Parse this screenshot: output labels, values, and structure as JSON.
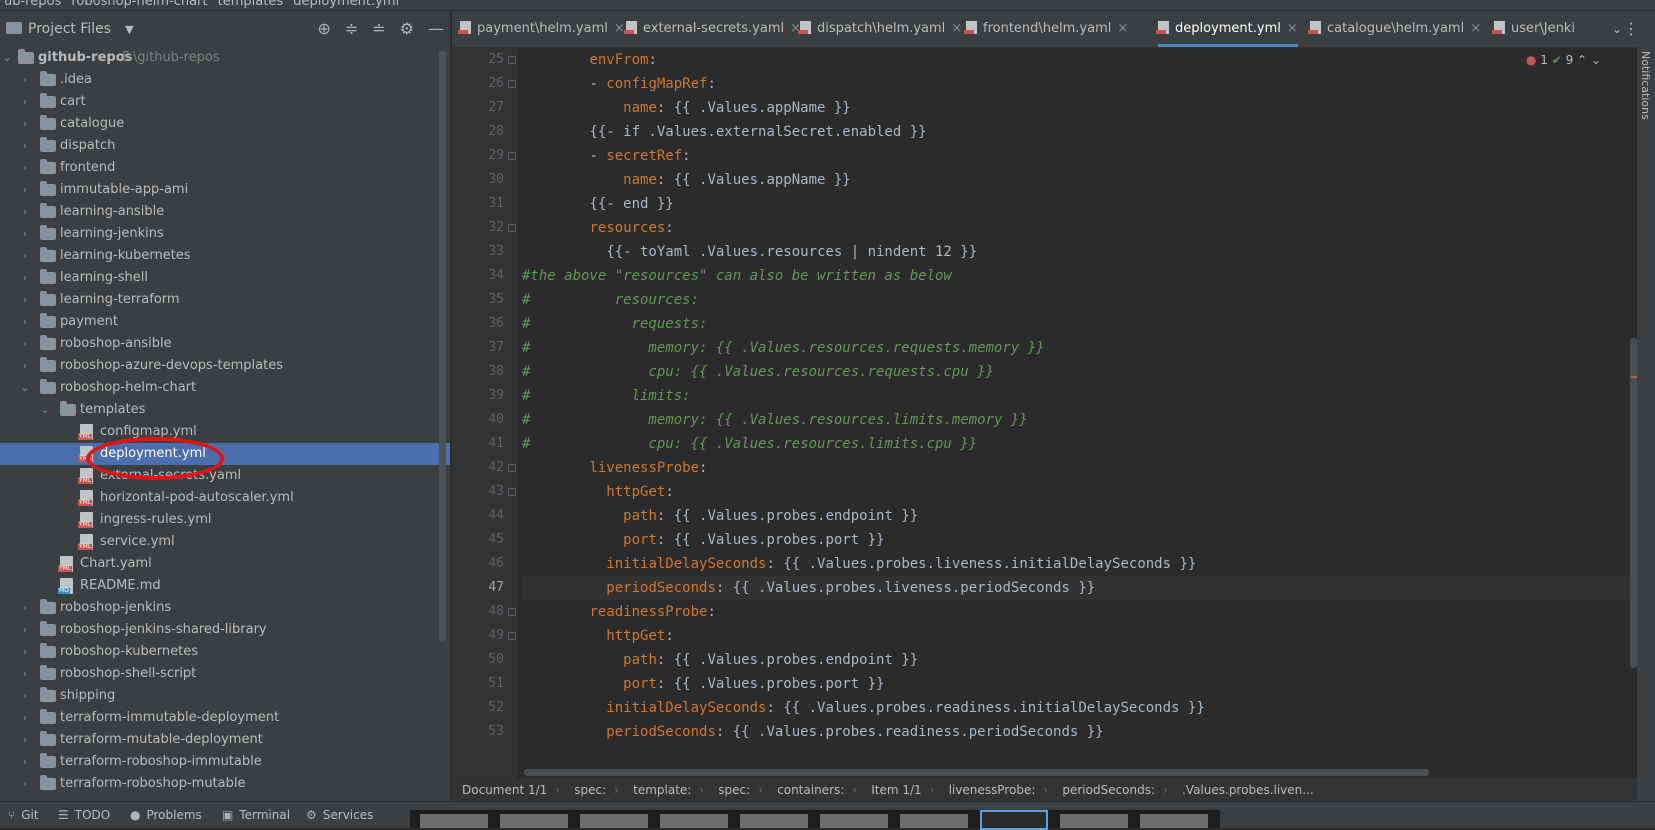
{
  "breadcrumb_top": [
    "ub-repos",
    "roboshop-helm-chart",
    "templates",
    "deployment.yml"
  ],
  "project_panel": {
    "title": "Project Files",
    "root": {
      "name": "github-repos",
      "path": "F:\\github-repos"
    },
    "items": [
      {
        "label": "idea"
      },
      {
        "label": "cart"
      },
      {
        "label": "catalogue"
      },
      {
        "label": "dispatch"
      },
      {
        "label": "frontend"
      },
      {
        "label": "immutable-app-ami"
      },
      {
        "label": "learning-ansible"
      },
      {
        "label": "learning-jenkins"
      },
      {
        "label": "learning-kubernetes"
      },
      {
        "label": "learning-shell"
      },
      {
        "label": "learning-terraform"
      },
      {
        "label": "payment"
      },
      {
        "label": "roboshop-ansible"
      },
      {
        "label": "roboshop-azure-devops-templates"
      },
      {
        "label": "roboshop-helm-chart"
      },
      {
        "label": "templates"
      },
      {
        "label": "configmap.yml"
      },
      {
        "label": "deployment.yml"
      },
      {
        "label": "external-secrets.yaml"
      },
      {
        "label": "horizontal-pod-autoscaler.yml"
      },
      {
        "label": "ingress-rules.yml"
      },
      {
        "label": "service.yml"
      },
      {
        "label": "Chart.yaml"
      },
      {
        "label": "README.md"
      },
      {
        "label": "roboshop-jenkins"
      },
      {
        "label": "roboshop-jenkins-shared-library"
      },
      {
        "label": "roboshop-kubernetes"
      },
      {
        "label": "roboshop-shell-script"
      },
      {
        "label": "shipping"
      },
      {
        "label": "terraform-immutable-deployment"
      },
      {
        "label": "terraform-mutable-deployment"
      },
      {
        "label": "terraform-roboshop-immutable"
      },
      {
        "label": "terraform-roboshop-mutable"
      }
    ]
  },
  "tabs": [
    {
      "label": "payment\\helm.yaml"
    },
    {
      "label": "external-secrets.yaml"
    },
    {
      "label": "dispatch\\helm.yaml"
    },
    {
      "label": "frontend\\helm.yaml"
    },
    {
      "label": "deployment.yml"
    },
    {
      "label": "catalogue\\helm.yaml"
    },
    {
      "label": "user\\Jenki"
    }
  ],
  "inspections": {
    "errors": "1",
    "ok": "9"
  },
  "editor": {
    "current_line": 47,
    "lines": [
      {
        "n": "25",
        "text": "        envFrom:"
      },
      {
        "n": "26",
        "text": "        - configMapRef:"
      },
      {
        "n": "27",
        "text": "            name: {{ .Values.appName }}"
      },
      {
        "n": "28",
        "text": "        {{- if .Values.externalSecret.enabled }}"
      },
      {
        "n": "29",
        "text": "        - secretRef:"
      },
      {
        "n": "30",
        "text": "            name: {{ .Values.appName }}"
      },
      {
        "n": "31",
        "text": "        {{- end }}"
      },
      {
        "n": "32",
        "text": "        resources:"
      },
      {
        "n": "33",
        "text": "          {{- toYaml .Values.resources | nindent 12 }}"
      },
      {
        "n": "34",
        "text": "#the above \"resources\" can also be written as below"
      },
      {
        "n": "35",
        "text": "#          resources:"
      },
      {
        "n": "36",
        "text": "#            requests:"
      },
      {
        "n": "37",
        "text": "#              memory: {{ .Values.resources.requests.memory }}"
      },
      {
        "n": "38",
        "text": "#              cpu: {{ .Values.resources.requests.cpu }}"
      },
      {
        "n": "39",
        "text": "#            limits:"
      },
      {
        "n": "40",
        "text": "#              memory: {{ .Values.resources.limits.memory }}"
      },
      {
        "n": "41",
        "text": "#              cpu: {{ .Values.resources.limits.cpu }}"
      },
      {
        "n": "42",
        "text": "        livenessProbe:"
      },
      {
        "n": "43",
        "text": "          httpGet:"
      },
      {
        "n": "44",
        "text": "            path: {{ .Values.probes.endpoint }}"
      },
      {
        "n": "45",
        "text": "            port: {{ .Values.probes.port }}"
      },
      {
        "n": "46",
        "text": "          initialDelaySeconds: {{ .Values.probes.liveness.initialDelaySeconds }}"
      },
      {
        "n": "47",
        "text": "          periodSeconds: {{ .Values.probes.liveness.periodSeconds }}"
      },
      {
        "n": "48",
        "text": "        readinessProbe:"
      },
      {
        "n": "49",
        "text": "          httpGet:"
      },
      {
        "n": "50",
        "text": "            path: {{ .Values.probes.endpoint }}"
      },
      {
        "n": "51",
        "text": "            port: {{ .Values.probes.port }}"
      },
      {
        "n": "52",
        "text": "          initialDelaySeconds: {{ .Values.probes.readiness.initialDelaySeconds }}"
      },
      {
        "n": "53",
        "text": "          periodSeconds: {{ .Values.probes.readiness.periodSeconds }}"
      }
    ]
  },
  "status_breadcrumbs": [
    "Document 1/1",
    "spec:",
    "template:",
    "spec:",
    "containers:",
    "Item 1/1",
    "livenessProbe:",
    "periodSeconds:",
    ".Values.probes.liven..."
  ],
  "bottom_tools": [
    {
      "label": "Git",
      "icon": "git-icon"
    },
    {
      "label": "TODO",
      "icon": "todo-icon"
    },
    {
      "label": "Problems",
      "icon": "problems-icon"
    },
    {
      "label": "Terminal",
      "icon": "terminal-icon"
    },
    {
      "label": "Services",
      "icon": "services-icon"
    }
  ],
  "notifications_label": "Notifications",
  "colors": {
    "accent": "#4b6eaf",
    "annotation_circle": "#e01414",
    "comment": "#629755",
    "keyword": "#cc7832"
  }
}
